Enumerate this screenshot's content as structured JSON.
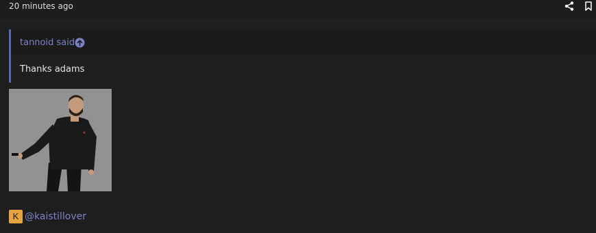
{
  "post": {
    "timestamp": "20 minutes ago"
  },
  "icons": {
    "share": "share-icon",
    "bookmark": "bookmark-icon",
    "quote_jump": "arrow-up-circle-icon"
  },
  "quote": {
    "author": "tannoid said:",
    "text": "Thanks adams"
  },
  "mention": {
    "avatar_letter": "K",
    "username": "@kaistillover"
  },
  "colors": {
    "accent": "#5b67b5",
    "link": "#7a83c6",
    "avatar_bg": "#e6a33e",
    "background": "#1e1e1e"
  }
}
